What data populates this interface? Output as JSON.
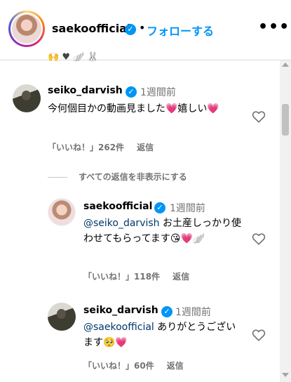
{
  "header": {
    "username": "saekoofficial",
    "dot": "•",
    "follow_label": "フォローする",
    "more": "•••"
  },
  "top_fragment": {
    "emojis": "🙌 ♥ 🪽 🐰"
  },
  "comments": [
    {
      "username": "seiko_darvish",
      "time": "1週間前",
      "text": "今何個目かの動画見ました💗嬉しい💗",
      "likes": "「いいね！」262件",
      "reply_label": "返信"
    }
  ],
  "hide_replies_label": "すべての返信を非表示にする",
  "replies": [
    {
      "username": "saekoofficial",
      "time": "1週間前",
      "mention": "@seiko_darvish",
      "text": " お土産しっかり使わせてもらってます😘💗🪽",
      "likes": "「いいね！」118件",
      "reply_label": "返信"
    },
    {
      "username": "seiko_darvish",
      "time": "1週間前",
      "mention": "@saekoofficial",
      "text": " ありがとうございます🥺💗",
      "likes": "「いいね！」60件",
      "reply_label": "返信"
    }
  ],
  "colors": {
    "accent": "#0095f6",
    "muted": "#737373",
    "mention": "#00376b"
  },
  "icons": {
    "verified": "verified-badge-icon",
    "like": "heart-outline-icon",
    "more": "more-options-icon"
  }
}
